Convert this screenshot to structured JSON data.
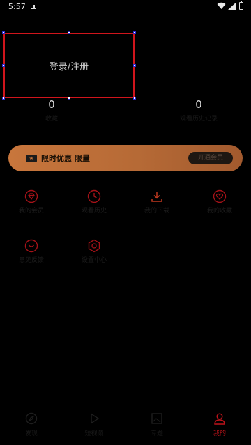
{
  "status_bar": {
    "time": "5:57"
  },
  "login": {
    "label": "登录/注册"
  },
  "stats": [
    {
      "value": "0",
      "label": "收藏"
    },
    {
      "value": "0",
      "label": "观看历史记录"
    }
  ],
  "vip_banner": {
    "title": "限时优惠 限量",
    "button": "开通会员"
  },
  "features": [
    {
      "label": "我的会员",
      "icon": "diamond-icon"
    },
    {
      "label": "观看历史",
      "icon": "clock-icon"
    },
    {
      "label": "我的下载",
      "icon": "download-icon"
    },
    {
      "label": "我的收藏",
      "icon": "heart-icon"
    },
    {
      "label": "意见反馈",
      "icon": "chat-icon"
    },
    {
      "label": "设置中心",
      "icon": "settings-icon"
    }
  ],
  "bottom_nav": [
    {
      "label": "发现",
      "icon": "compass-icon"
    },
    {
      "label": "短视频",
      "icon": "play-icon"
    },
    {
      "label": "专题",
      "icon": "image-icon"
    },
    {
      "label": "我的",
      "icon": "person-icon",
      "active": true
    }
  ],
  "colors": {
    "accent": "#d0151c",
    "banner_gold": "#c8763c",
    "background": "#000000"
  }
}
